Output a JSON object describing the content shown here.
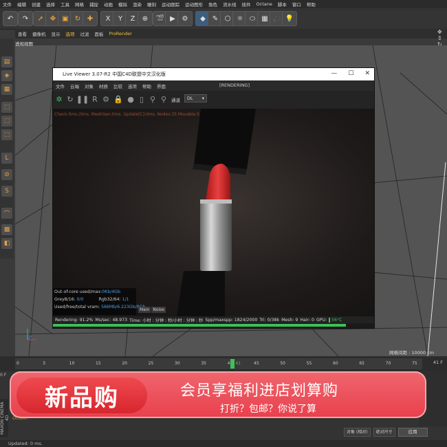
{
  "menubar": [
    "文件",
    "编辑",
    "创建",
    "选择",
    "工具",
    "网格",
    "捕捉",
    "动画",
    "模拟",
    "渲染",
    "雕刻",
    "运动跟踪",
    "运动图形",
    "角色",
    "流水线",
    "插件",
    "Octane",
    "脚本",
    "窗口",
    "帮助"
  ],
  "subbar": {
    "items": [
      "查看",
      "摄像机",
      "显示",
      "选项",
      "过滤",
      "面板"
    ],
    "prorender": "ProRender"
  },
  "viewport": {
    "label": "透视视图",
    "grid": "网格间距 : 10000 cm"
  },
  "live_viewer": {
    "title": "Live Viewer 3.07-R2 中国C4D联盟中文汉化版",
    "window_buttons": [
      "—",
      "☐",
      "✕"
    ],
    "menu": [
      "文件",
      "云端",
      "对象",
      "材质",
      "比较",
      "选项",
      "帮助",
      "界面"
    ],
    "rendering_label": "[RENDERING]",
    "mode_label": "通道",
    "mode_value": "DL",
    "stats_top": "Check:0ms./0ms. MeshGen:0ms. Update[C]:0ms. Nodes:35 Movable:5  0 0",
    "info": {
      "out_of_core_label": "Out-of-core used/max:",
      "out_of_core_value": "0Kb/4Gb",
      "grey_label": "Grey8/16: ",
      "grey_value": "0/0",
      "rgb_label": "Rgb32/64: ",
      "rgb_value": "1/1",
      "vram_label": "Used/free/total vram: ",
      "vram_value": "566Mb/6.223Gb/8Gb"
    },
    "tabs": [
      "Main",
      "Noise"
    ],
    "status": [
      "Rendering: 91.2%",
      "Ms/sec: 48.973",
      "Time: 小时 : 分钟 : 秒/小时 : 分钟 : 秒",
      "Spp/maxspp: 1824/2000",
      "Tri: 0/38k",
      "Mesh: 9",
      "Hair: 0",
      "GPU: ",
      "56°C"
    ],
    "progress": 0.912
  },
  "timeline": {
    "ticks": [
      "0",
      "5",
      "10",
      "15",
      "20",
      "25",
      "30",
      "35",
      "40",
      "45",
      "50",
      "55",
      "60",
      "65",
      "70",
      "75"
    ],
    "current": "41",
    "end": "41 F"
  },
  "bottom": {
    "left_label": "0 F",
    "octdin": "OctDin",
    "maxon": "MAXON CINEMA 4D",
    "coord_mode": "对象 (相对)",
    "size_mode": "绝对尺寸",
    "apply": "应用"
  },
  "banner": {
    "left": "新品购",
    "title": "会员享福利进店划算购",
    "subtitle": "打折？包邮？你说了算"
  },
  "statusbar": "Updated: 0 ms.",
  "colors": {
    "accent_green": "#3fc05a",
    "banner_red": "#e8404c",
    "info_blue": "#49a3e8"
  }
}
